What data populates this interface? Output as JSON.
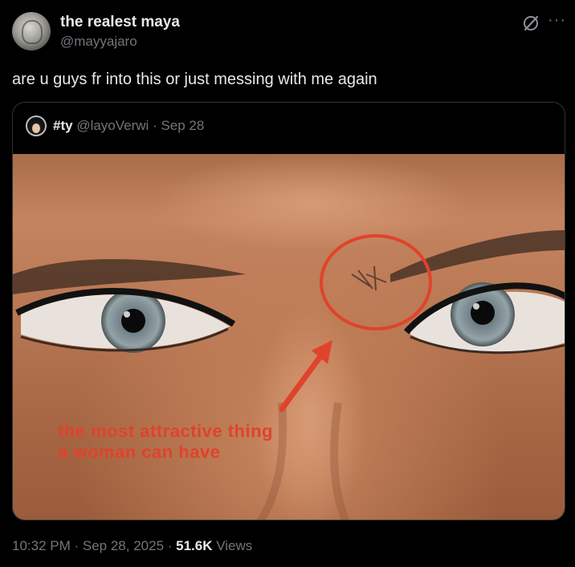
{
  "tweet": {
    "display_name": "the realest maya",
    "handle": "@mayyajaro",
    "text": "are u guys fr into this or just messing with me again",
    "time": "10:32 PM",
    "date": "Sep 28, 2025",
    "views_count": "51.6K",
    "views_label": "Views",
    "separator": " · "
  },
  "quote": {
    "name": "#ty",
    "handle": "@layoVerwi",
    "date": "Sep 28",
    "separator": " · "
  },
  "media": {
    "caption_line1": "the most attractive thing",
    "caption_line2": "a woman can have",
    "annotation_color": "#e0432b"
  },
  "icons": {
    "grok": "grok-icon",
    "more": "more-icon"
  },
  "colors": {
    "background": "#000000",
    "text": "#e7e9ea",
    "muted": "#71767b",
    "border": "#2f3336"
  }
}
